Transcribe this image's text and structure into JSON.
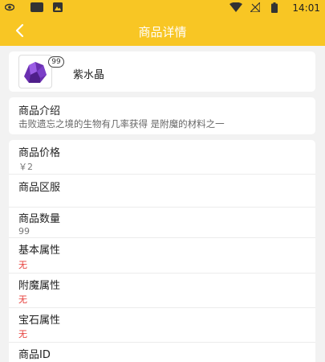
{
  "status_bar": {
    "time": "14:01"
  },
  "header": {
    "title": "商品详情"
  },
  "item": {
    "name": "紫水晶",
    "count": "99"
  },
  "intro": {
    "label": "商品介绍",
    "text": "击败遗忘之境的生物有几率获得 是附魔的材料之一"
  },
  "details": [
    {
      "label": "商品价格",
      "value": "￥2"
    },
    {
      "label": "商品区服",
      "value": ""
    },
    {
      "label": "商品数量",
      "value": "99"
    },
    {
      "label": "基本属性",
      "value": "无"
    },
    {
      "label": "附魔属性",
      "value": "无"
    },
    {
      "label": "宝石属性",
      "value": "无"
    },
    {
      "label": "商品ID",
      "value": ""
    }
  ],
  "colors": {
    "accent": "#f8c624",
    "negative_value": "#e53935"
  }
}
